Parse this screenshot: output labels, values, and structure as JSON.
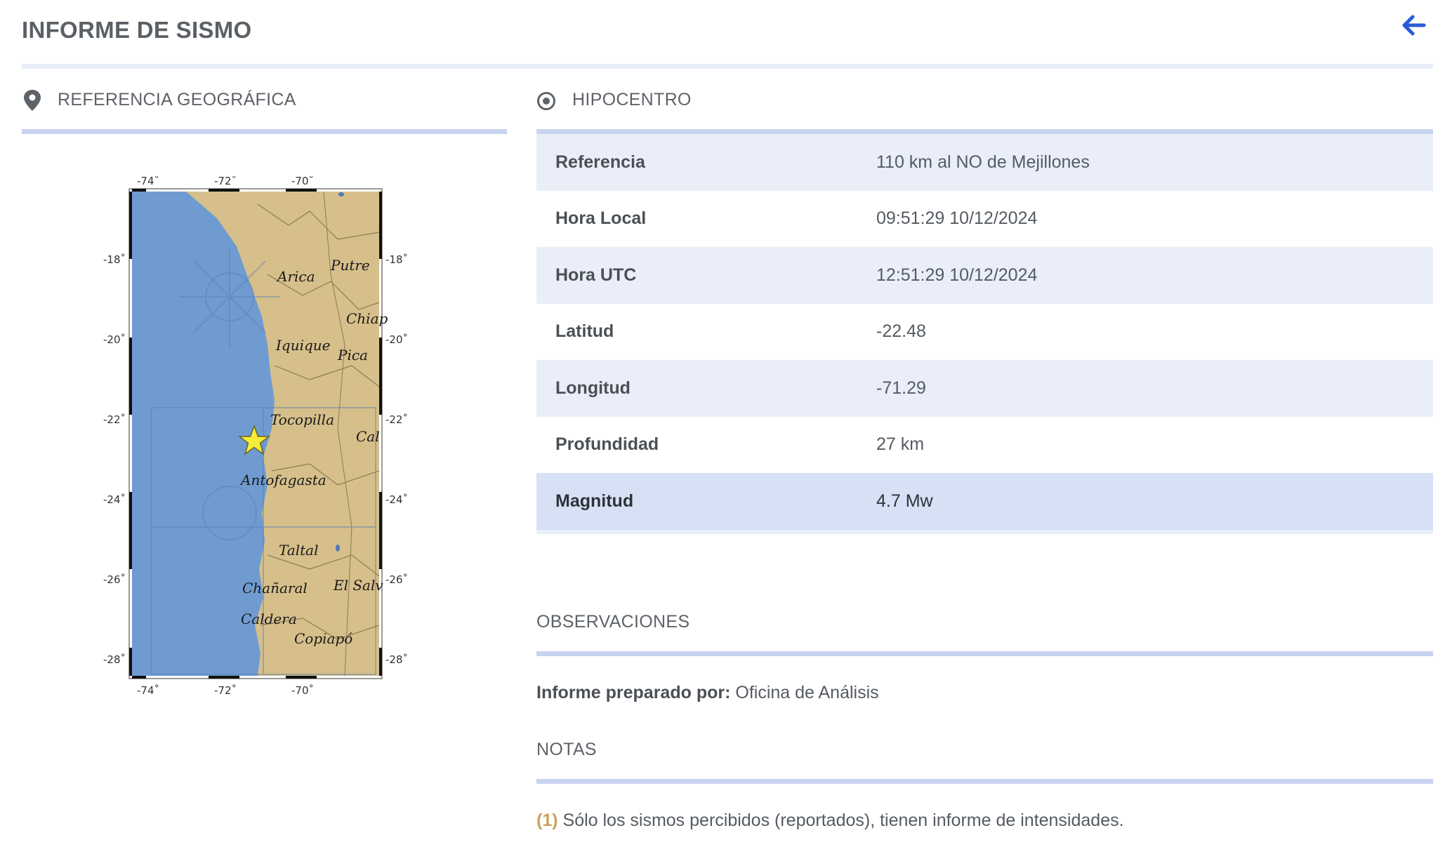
{
  "header": {
    "title": "INFORME DE SISMO",
    "back_icon": "arrow-left-icon",
    "accent_color": "#2a5bd7"
  },
  "geo": {
    "title": "REFERENCIA GEOGRÁFICA",
    "icon": "map-pin-icon",
    "map": {
      "top_ticks": [
        "-74˚",
        "-72˚",
        "-70˚"
      ],
      "bottom_ticks": [
        "-74˚",
        "-72˚",
        "-70˚"
      ],
      "left_ticks": [
        "-18˚",
        "-20˚",
        "-22˚",
        "-24˚",
        "-26˚",
        "-28˚"
      ],
      "right_ticks": [
        "-18˚",
        "-20˚",
        "-22˚",
        "-24˚",
        "-26˚",
        "-28˚"
      ],
      "places": [
        "Putre",
        "Arica",
        "Chiap",
        "Iquique",
        "Pica",
        "Tocopilla",
        "Cal",
        "Antofagasta",
        "Taltal",
        "Chañaral",
        "El Salv",
        "Caldera",
        "Copiapó"
      ],
      "epicenter_marker": "star-icon",
      "sea_color": "#6f9bd1",
      "land_color": "#d6bf8a"
    }
  },
  "hypo": {
    "title": "HIPOCENTRO",
    "icon": "target-icon",
    "rows": [
      {
        "label": "Referencia",
        "value": "110 km al NO de Mejillones"
      },
      {
        "label": "Hora Local",
        "value": "09:51:29 10/12/2024"
      },
      {
        "label": "Hora UTC",
        "value": "12:51:29 10/12/2024"
      },
      {
        "label": "Latitud",
        "value": "-22.48"
      },
      {
        "label": "Longitud",
        "value": "-71.29"
      },
      {
        "label": "Profundidad",
        "value": "27 km"
      },
      {
        "label": "Magnitud",
        "value": "4.7 Mw"
      }
    ]
  },
  "observaciones": {
    "title": "OBSERVACIONES",
    "prepared_label": "Informe preparado por:",
    "prepared_value": "Oficina de Análisis"
  },
  "notas": {
    "title": "NOTAS",
    "number": "(1)",
    "text": "Sólo los sismos percibidos (reportados), tienen informe de intensidades."
  }
}
